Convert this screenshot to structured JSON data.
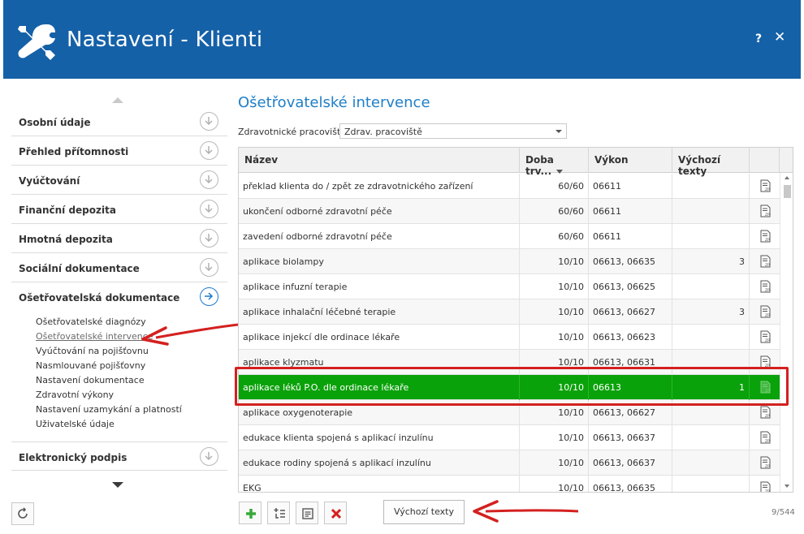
{
  "window": {
    "title": "Nastavení - Klienti",
    "help_label": "?",
    "close_label": "✕"
  },
  "sidebar": {
    "sections": [
      {
        "label": "Osobní údaje"
      },
      {
        "label": "Přehled přítomnosti"
      },
      {
        "label": "Vyúčtování"
      },
      {
        "label": "Finanční depozita"
      },
      {
        "label": "Hmotná depozita"
      },
      {
        "label": "Sociální dokumentace"
      },
      {
        "label": "Ošetřovatelská dokumentace"
      },
      {
        "label": "Elektronický podpis"
      }
    ],
    "subitems": [
      "Ošetřovatelské diagnózy",
      "Ošetřovatelské intervence",
      "Vyúčtování na pojišťovnu",
      "Nasmlouvané pojišťovny",
      "Nastavení dokumentace",
      "Zdravotní výkony",
      "Nastavení uzamykání a platností",
      "Uživatelské údaje"
    ]
  },
  "main": {
    "title": "Ošetřovatelské intervence",
    "filter_label": "Zdravotnické pracoviště:",
    "filter_value": "Zdrav. pracoviště",
    "columns": [
      "Název",
      "Doba trv...",
      "Výkon",
      "Výchozí texty"
    ],
    "rows": [
      {
        "name": "překlad klienta do / zpět ze zdravotnického zařízení",
        "doba": "60/60",
        "vykon": "06611",
        "texty": ""
      },
      {
        "name": "ukončení odborné zdravotní péče",
        "doba": "60/60",
        "vykon": "06611",
        "texty": ""
      },
      {
        "name": "zavedení odborné zdravotní péče",
        "doba": "60/60",
        "vykon": "06611",
        "texty": ""
      },
      {
        "name": "aplikace biolampy",
        "doba": "10/10",
        "vykon": "06613, 06635",
        "texty": "3"
      },
      {
        "name": "aplikace infuzní terapie",
        "doba": "10/10",
        "vykon": "06613, 06625",
        "texty": ""
      },
      {
        "name": "aplikace inhalační léčebné terapie",
        "doba": "10/10",
        "vykon": "06613, 06627",
        "texty": "3"
      },
      {
        "name": "aplikace injekcí dle ordinace lékaře",
        "doba": "10/10",
        "vykon": "06613, 06623",
        "texty": ""
      },
      {
        "name": "aplikace klyzmatu",
        "doba": "10/10",
        "vykon": "06613, 06631",
        "texty": ""
      },
      {
        "name": "aplikace léků P.O. dle ordinace lékaře",
        "doba": "10/10",
        "vykon": "06613",
        "texty": "1"
      },
      {
        "name": "aplikace oxygenoterapie",
        "doba": "10/10",
        "vykon": "06613, 06627",
        "texty": ""
      },
      {
        "name": "edukace klienta spojená s aplikací inzulínu",
        "doba": "10/10",
        "vykon": "06613, 06637",
        "texty": ""
      },
      {
        "name": "edukace rodiny spojená s aplikací inzulínu",
        "doba": "10/10",
        "vykon": "06613, 06637",
        "texty": ""
      },
      {
        "name": "EKG",
        "doba": "10/10",
        "vykon": "06613, 06635",
        "texty": ""
      }
    ],
    "selected_row": "aplikace léků P.O. dle ordinace lékaře",
    "toolbar": {
      "default_texts_button": "Výchozí texty"
    },
    "counter": "9/544"
  },
  "colors": {
    "header": "#1561a8",
    "accent": "#1f7fc7",
    "selected_row": "#0aa20a",
    "annotation_red": "#d42020"
  }
}
